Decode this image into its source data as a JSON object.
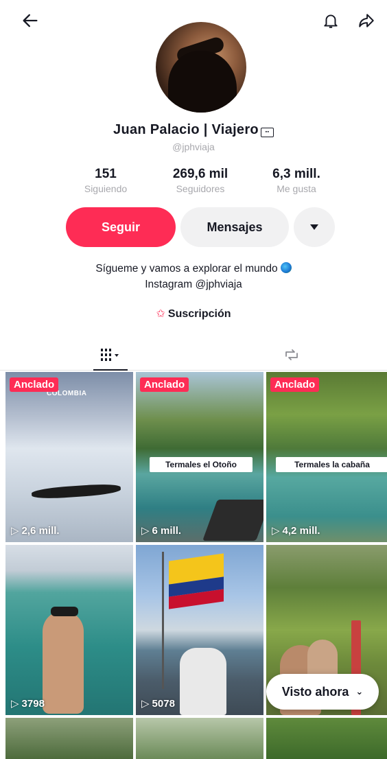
{
  "header": {
    "back_icon": "arrow-left-icon",
    "bell_icon": "bell-icon",
    "share_icon": "share-arrow-icon"
  },
  "profile": {
    "name": "Juan  Palacio  |  Viajero",
    "badge_icon": "tv-badge-icon",
    "handle": "@jphviaja",
    "stats": [
      {
        "value": "151",
        "label": "Siguiendo"
      },
      {
        "value": "269,6 mil",
        "label": "Seguidores"
      },
      {
        "value": "6,3 mill.",
        "label": "Me gusta"
      }
    ],
    "buttons": {
      "follow": "Seguir",
      "message": "Mensajes",
      "more_icon": "caret-down-icon"
    },
    "bio_line1": "Sígueme y vamos a explorar el mundo",
    "bio_line2": "Instagram @jphviaja",
    "subscription": "Suscripción"
  },
  "tabs": {
    "grid_icon": "video-grid-icon",
    "repost_icon": "repost-icon"
  },
  "videos": [
    {
      "pinned": "Anclado",
      "views": "2,6 mill.",
      "overlay": "COLOMBIA"
    },
    {
      "pinned": "Anclado",
      "views": "6 mill.",
      "caption": "Termales el Otoño"
    },
    {
      "pinned": "Anclado",
      "views": "4,2 mill.",
      "caption": "Termales la cabaña"
    },
    {
      "views": "3798"
    },
    {
      "views": "5078"
    },
    {
      "views": ""
    },
    {},
    {},
    {}
  ],
  "floating": {
    "visto_label": "Visto ahora"
  },
  "colors": {
    "accent": "#fe2c55",
    "secondary_button": "#f1f1f2",
    "muted_text": "#a8a8ad"
  }
}
